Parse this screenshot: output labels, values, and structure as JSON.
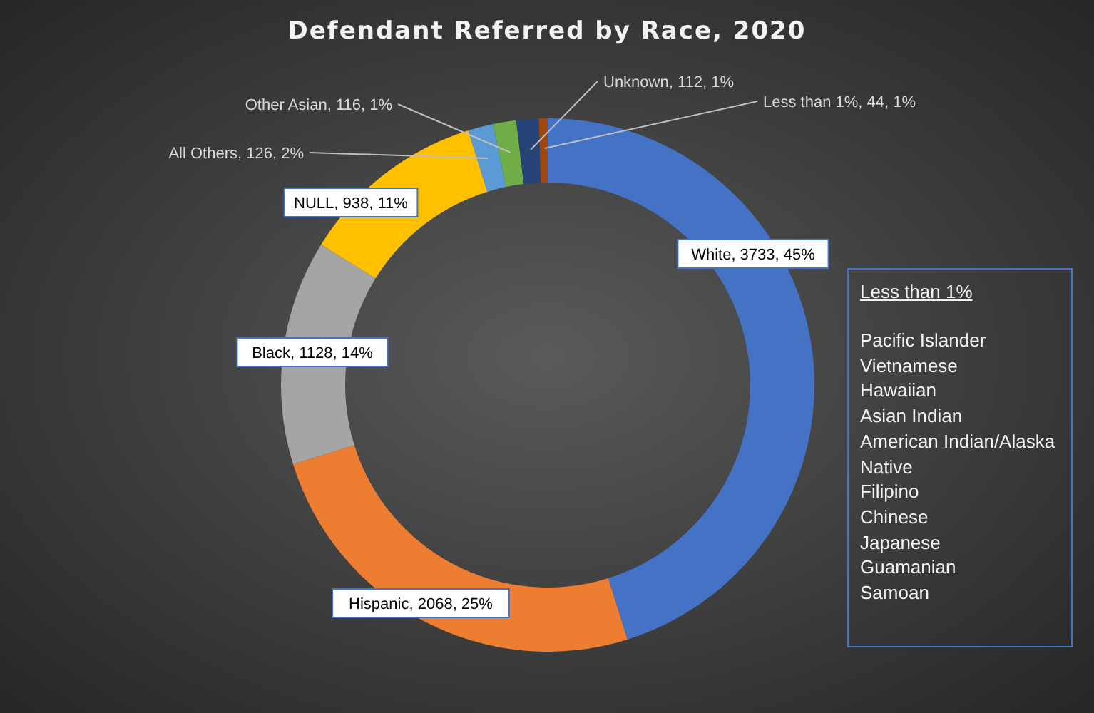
{
  "chart": {
    "chart_data": {
      "type": "donut",
      "title": "Defendant Referred by Race, 2020",
      "values": [
        3733,
        2068,
        1128,
        938,
        126,
        116,
        112,
        44
      ],
      "value_labels": [
        "White, 3733, 45%",
        "Hispanic, 2068, 25%",
        "Black, 1128, 14%",
        "NULL, 938, 11%",
        "All Others, 126, 2%",
        "Other Asian, 116, 1%",
        "Unknown, 112, 1%",
        "Less than 1%, 44, 1%"
      ],
      "colors": [
        "#4472c4",
        "#ed7d31",
        "#a5a5a5",
        "#ffc000",
        "#5b9bd5",
        "#70ad47",
        "#264478",
        "#9e480e"
      ]
    }
  },
  "note": {
    "heading": "Less than 1%",
    "items": [
      "Pacific Islander",
      "Vietnamese",
      "Hawaiian",
      "Asian Indian",
      "American Indian/Alaska Native",
      "Filipino",
      "Chinese",
      "Japanese",
      "Guamanian",
      "Samoan"
    ]
  }
}
